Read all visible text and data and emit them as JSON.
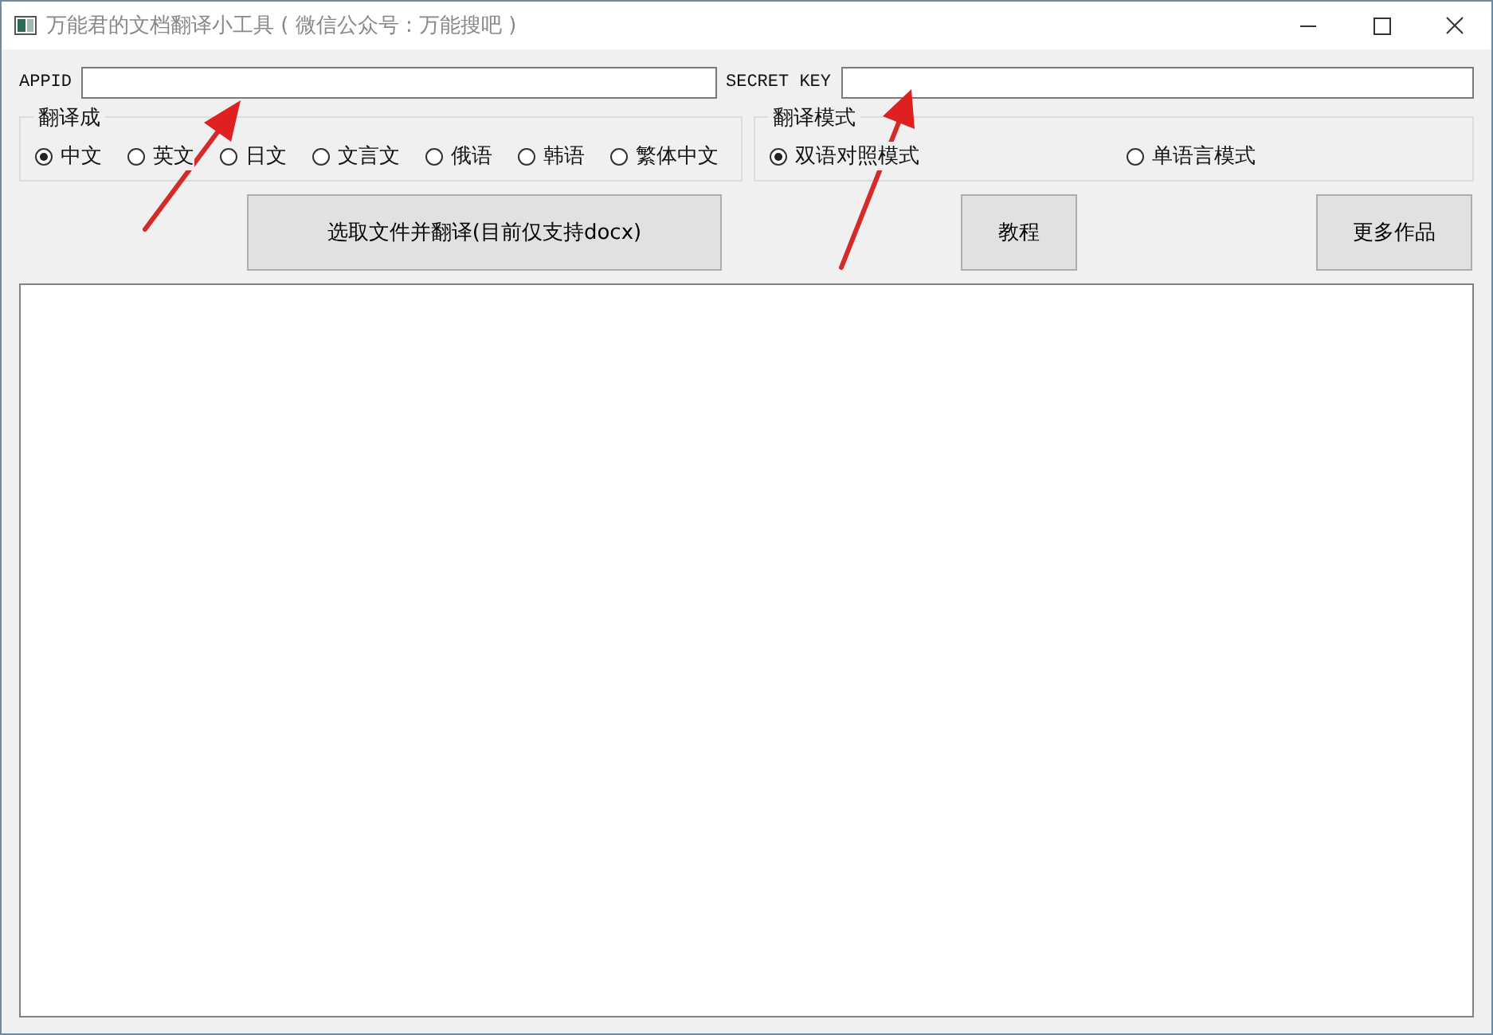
{
  "window": {
    "title": "万能君的文档翻译小工具 ( 微信公众号 : 万能搜吧 )"
  },
  "credentials": [
    {
      "label": "APPID"
    },
    {
      "label": "SECRET KEY"
    }
  ],
  "target_language": {
    "title": "翻译成",
    "options": [
      {
        "label": "中文",
        "selected": true
      },
      {
        "label": "英文",
        "selected": false
      },
      {
        "label": "日文",
        "selected": false
      },
      {
        "label": "文言文",
        "selected": false
      },
      {
        "label": "俄语",
        "selected": false
      },
      {
        "label": "韩语",
        "selected": false
      },
      {
        "label": "繁体中文",
        "selected": false
      }
    ]
  },
  "translation_mode": {
    "title": "翻译模式",
    "options": [
      {
        "label": "双语对照模式",
        "selected": true
      },
      {
        "label": "单语言模式",
        "selected": false
      }
    ]
  },
  "buttons": [
    {
      "label": "选取文件并翻译(目前仅支持docx)"
    },
    {
      "label": "教程"
    },
    {
      "label": "更多作品"
    }
  ]
}
